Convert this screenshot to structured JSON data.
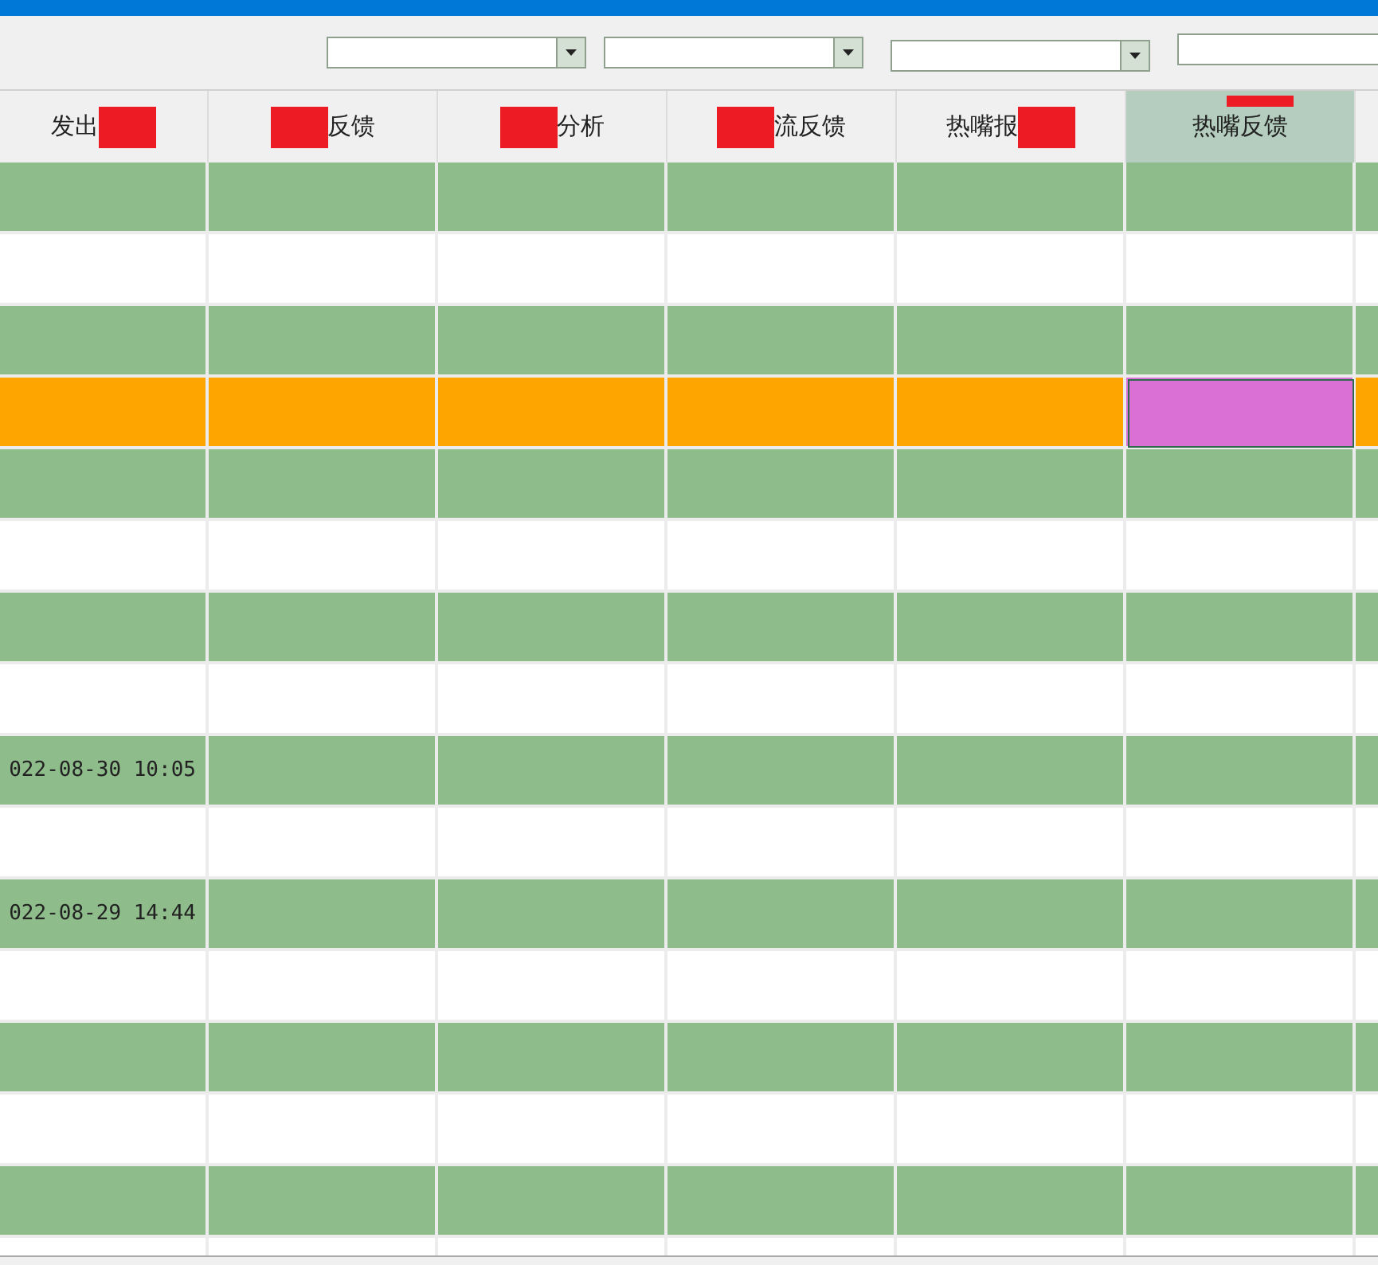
{
  "filters": [
    {
      "kind": "dropdown"
    },
    {
      "kind": "dropdown"
    },
    {
      "kind": "dropdown"
    },
    {
      "kind": "text"
    }
  ],
  "table": {
    "columns": [
      {
        "label": "发出",
        "kind": "redacted-after",
        "selected": false
      },
      {
        "label": "反馈",
        "kind": "redacted-before",
        "selected": false
      },
      {
        "label": "分析",
        "kind": "redacted-before",
        "selected": false
      },
      {
        "label": "流反馈",
        "kind": "redacted-before",
        "selected": false
      },
      {
        "label": "热嘴报",
        "kind": "redacted-after",
        "selected": false
      },
      {
        "label": "热嘴反馈",
        "kind": "redacted-over",
        "selected": true
      }
    ],
    "rows": [
      {
        "color": "#8fbc8b",
        "selected": false
      },
      {
        "color": "#ffffff",
        "selected": false
      },
      {
        "color": "#8fbc8b",
        "selected": false
      },
      {
        "color": "#ffa500",
        "selected": true
      },
      {
        "color": "#8fbc8b",
        "selected": false
      },
      {
        "color": "#ffffff",
        "selected": false
      },
      {
        "color": "#8fbc8b",
        "selected": false
      },
      {
        "color": "#ffffff",
        "selected": false
      },
      {
        "color": "#8fbc8b",
        "selected": false,
        "text": "022-08-30 10:05"
      },
      {
        "color": "#ffffff",
        "selected": false
      },
      {
        "color": "#8fbc8b",
        "selected": false,
        "text": "022-08-29 14:44"
      },
      {
        "color": "#ffffff",
        "selected": false
      },
      {
        "color": "#8fbc8b",
        "selected": false
      },
      {
        "color": "#ffffff",
        "selected": false
      },
      {
        "color": "#8fbc8b",
        "selected": false
      },
      {
        "color": "#ffffff",
        "selected": false
      }
    ]
  }
}
